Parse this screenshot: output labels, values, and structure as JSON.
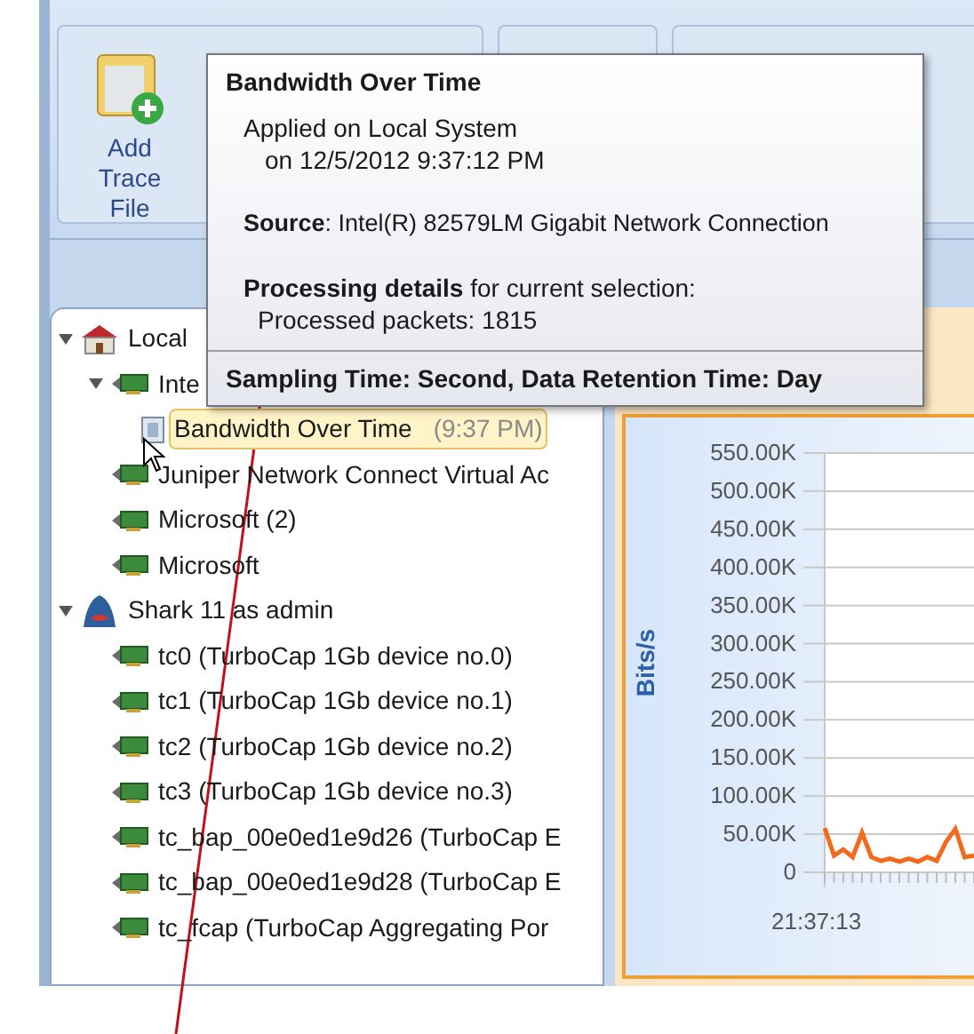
{
  "ribbon": {
    "buttons": [
      {
        "label": "Add Trace File",
        "kind": "big"
      }
    ]
  },
  "tree_panel": {
    "items": [
      {
        "label": "Local",
        "kind": "house",
        "expanded": true,
        "children": [
          {
            "label": "Inte",
            "kind": "card",
            "expanded": true,
            "children": [
              {
                "label": "Bandwidth Over Time",
                "time": "(9:37 PM)",
                "kind": "report",
                "selected": true
              }
            ]
          },
          {
            "label": "Juniper Network Connect Virtual Ac",
            "kind": "card",
            "selected": false
          },
          {
            "label": "Microsoft (2)",
            "kind": "card",
            "selected": false
          },
          {
            "label": "Microsoft",
            "kind": "card",
            "selected": false
          }
        ]
      },
      {
        "label": "Shark 11 as admin",
        "kind": "shark",
        "expanded": true,
        "children": [
          {
            "label": "tc0 (TurboCap 1Gb device no.0)",
            "kind": "card",
            "selected": false
          },
          {
            "label": "tc1 (TurboCap 1Gb device no.1)",
            "kind": "card",
            "selected": false
          },
          {
            "label": "tc2 (TurboCap 1Gb device no.2)",
            "kind": "card",
            "selected": false
          },
          {
            "label": "tc3 (TurboCap 1Gb device no.3)",
            "kind": "card",
            "selected": false
          },
          {
            "label": "tc_bap_00e0ed1e9d26 (TurboCap E",
            "kind": "card",
            "selected": false
          },
          {
            "label": "tc_bap_00e0ed1e9d28 (TurboCap E",
            "kind": "card",
            "selected": false
          },
          {
            "label": "tc_fcap (TurboCap Aggregating Por",
            "kind": "card",
            "selected": false
          }
        ]
      }
    ]
  },
  "chart_panel": {
    "start_time": "21:37:13",
    "chart_data": {
      "type": "line",
      "ylabel": "Bits/s",
      "grid": true,
      "series": [
        {
          "color": "#f26a1b",
          "values": [
            58000,
            22000,
            30000,
            20000,
            52000,
            20000,
            15000,
            18000,
            14000,
            18000,
            14000,
            20000,
            15000,
            40000,
            57000,
            20000,
            22000
          ]
        }
      ],
      "ylim": [
        0,
        550000
      ],
      "yticks": [
        {
          "value": 0,
          "label": "0"
        },
        {
          "value": 50000,
          "label": "50.00K"
        },
        {
          "value": 100000,
          "label": "100.00K"
        },
        {
          "value": 150000,
          "label": "150.00K"
        },
        {
          "value": 200000,
          "label": "200.00K"
        },
        {
          "value": 250000,
          "label": "250.00K"
        },
        {
          "value": 300000,
          "label": "300.00K"
        },
        {
          "value": 350000,
          "label": "350.00K"
        },
        {
          "value": 400000,
          "label": "400.00K"
        },
        {
          "value": 450000,
          "label": "450.00K"
        },
        {
          "value": 500000,
          "label": "500.00K"
        },
        {
          "value": 550000,
          "label": "550.00K"
        }
      ]
    }
  },
  "tooltip": {
    "title": "Bandwidth Over Time",
    "applied": "Applied on Local System",
    "date": "on 12/5/2012 9:37:12 PM",
    "source": "**Source**: Intel(R) 82579LM Gigabit Network Connection",
    "processing": "**Processing details** for current selection:",
    "packets": "Processed packets: 1815",
    "footer": "Sampling Time: Second, Data Retention Time: Day"
  }
}
